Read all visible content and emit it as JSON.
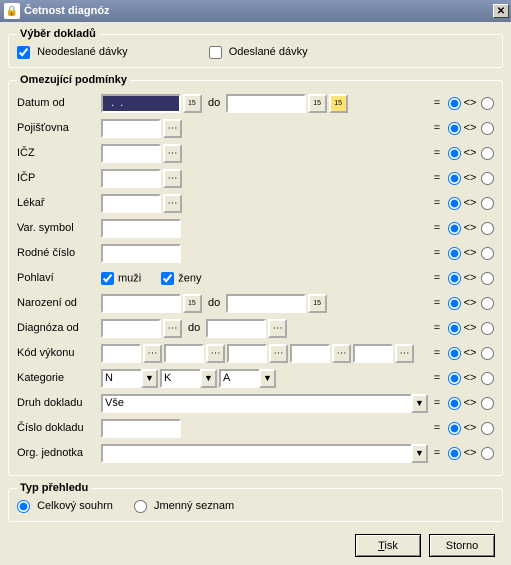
{
  "title": "Četnost diagnóz",
  "group_vyber": {
    "legend": "Výběr dokladů",
    "neodeslane": "Neodeslané dávky",
    "odeslane": "Odeslané dávky",
    "neodeslane_checked": true,
    "odeslane_checked": false
  },
  "group_omez": {
    "legend": "Omezující podmínky",
    "labels": {
      "datum_od": "Datum od",
      "do": "do",
      "pojistovna": "Pojišťovna",
      "icž": "IČZ",
      "icp": "IČP",
      "lekar": "Lékař",
      "var_symbol": "Var. symbol",
      "rodne_cislo": "Rodné číslo",
      "pohlavi": "Pohlaví",
      "muzi": "muži",
      "zeny": "ženy",
      "narozeni_od": "Narození od",
      "diagnoza_od": "Diagnóza od",
      "kod_vykonu": "Kód výkonu",
      "kategorie": "Kategorie",
      "druh_dokladu": "Druh dokladu",
      "cislo_dokladu": "Číslo dokladu",
      "org_jednotka": "Org. jednotka"
    },
    "values": {
      "datum_od": "  .  .    ",
      "datum_do": "",
      "pojistovna": "",
      "icž": "",
      "icp": "",
      "lekar": "",
      "var_symbol": "",
      "rodne_cislo": "",
      "narozeni_od": "",
      "narozeni_do": "",
      "diagnoza_od": "",
      "diagnoza_do": "",
      "kod1": "",
      "kod2": "",
      "kod3": "",
      "kod4": "",
      "kod5": "",
      "kategorie1": "N",
      "kategorie2": "K",
      "kategorie3": "A",
      "druh_dokladu": "Vše",
      "cislo_dokladu": "",
      "org_jednotka": ""
    },
    "op": {
      "eq": "=",
      "ne": "<>"
    }
  },
  "group_typ": {
    "legend": "Typ přehledu",
    "celkovy": "Celkový souhrn",
    "jmenny": "Jmenný seznam"
  },
  "buttons": {
    "tisk": "Tisk",
    "storno": "Storno"
  }
}
